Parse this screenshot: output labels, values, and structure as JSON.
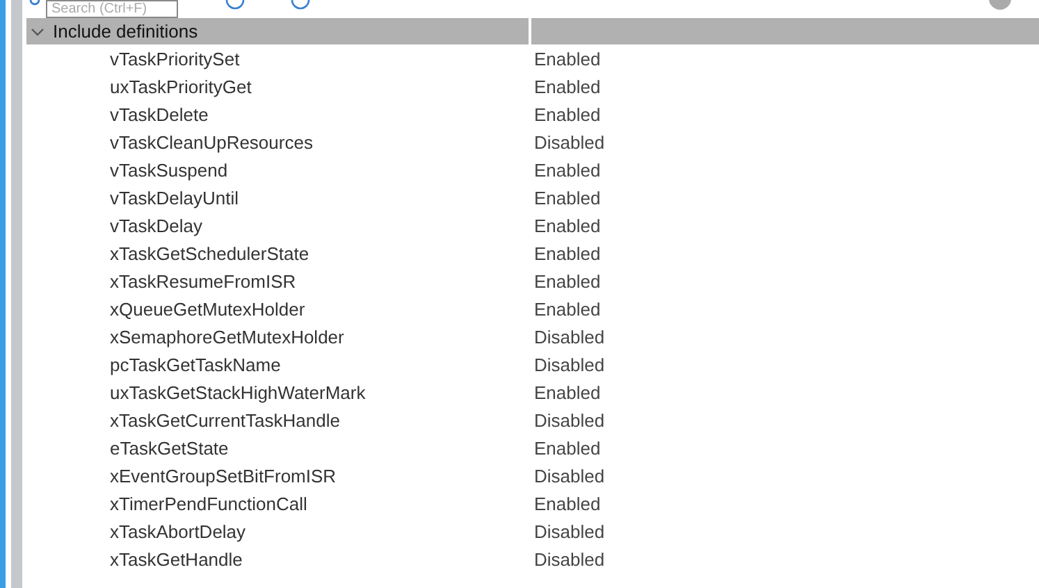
{
  "search": {
    "placeholder": "Search (Ctrl+F)"
  },
  "group": {
    "label": "Include definitions",
    "expanded": true
  },
  "rows": [
    {
      "name": "vTaskPrioritySet",
      "value": "Enabled"
    },
    {
      "name": "uxTaskPriorityGet",
      "value": "Enabled"
    },
    {
      "name": "vTaskDelete",
      "value": "Enabled"
    },
    {
      "name": "vTaskCleanUpResources",
      "value": "Disabled"
    },
    {
      "name": "vTaskSuspend",
      "value": "Enabled"
    },
    {
      "name": "vTaskDelayUntil",
      "value": "Enabled"
    },
    {
      "name": "vTaskDelay",
      "value": "Enabled"
    },
    {
      "name": "xTaskGetSchedulerState",
      "value": "Enabled"
    },
    {
      "name": "xTaskResumeFromISR",
      "value": "Enabled"
    },
    {
      "name": "xQueueGetMutexHolder",
      "value": "Enabled"
    },
    {
      "name": "xSemaphoreGetMutexHolder",
      "value": "Disabled"
    },
    {
      "name": "pcTaskGetTaskName",
      "value": "Disabled"
    },
    {
      "name": "uxTaskGetStackHighWaterMark",
      "value": "Enabled"
    },
    {
      "name": "xTaskGetCurrentTaskHandle",
      "value": "Disabled"
    },
    {
      "name": "eTaskGetState",
      "value": "Enabled"
    },
    {
      "name": "xEventGroupSetBitFromISR",
      "value": "Disabled"
    },
    {
      "name": "xTimerPendFunctionCall",
      "value": "Enabled"
    },
    {
      "name": "xTaskAbortDelay",
      "value": "Disabled"
    },
    {
      "name": "xTaskGetHandle",
      "value": "Disabled"
    }
  ]
}
